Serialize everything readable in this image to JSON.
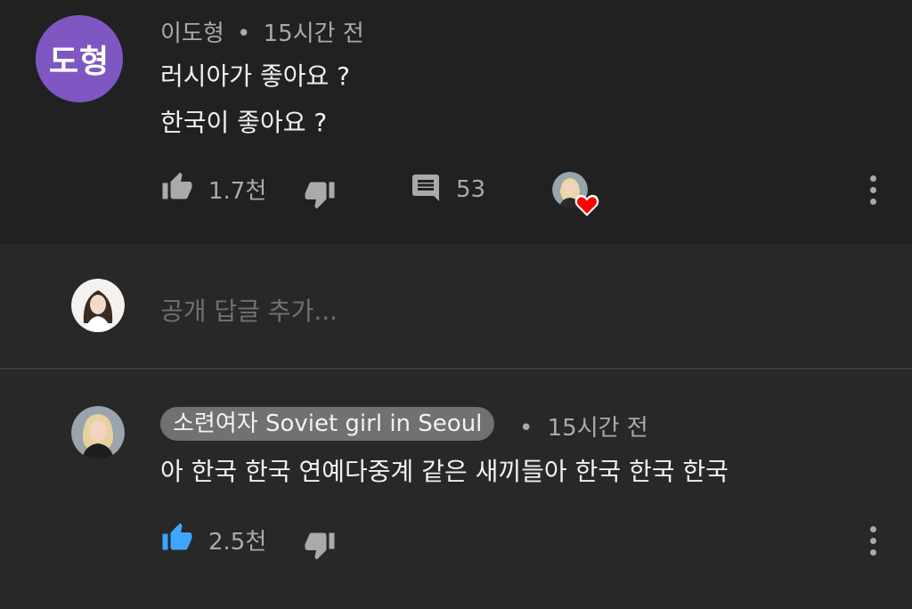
{
  "top_comment": {
    "avatar_initials": "도형",
    "author": "이도형",
    "separator": "•",
    "time": "15시간 전",
    "lines": [
      "러시아가 좋아요 ?",
      "한국이 좋아요 ?"
    ],
    "likes": "1.7천",
    "replies": "53",
    "colors": {
      "avatar_bg": "#7e57c2",
      "heart": "#ff0000"
    }
  },
  "reply_box": {
    "placeholder": "공개 답글 추가..."
  },
  "reply": {
    "author": "소련여자 Soviet girl in Seoul",
    "separator": "•",
    "time": "15시간 전",
    "text": "아 한국 한국 연예다중계 같은 새끼들아 한국 한국 한국",
    "likes": "2.5천",
    "colors": {
      "like_active": "#3ea6ff"
    }
  }
}
